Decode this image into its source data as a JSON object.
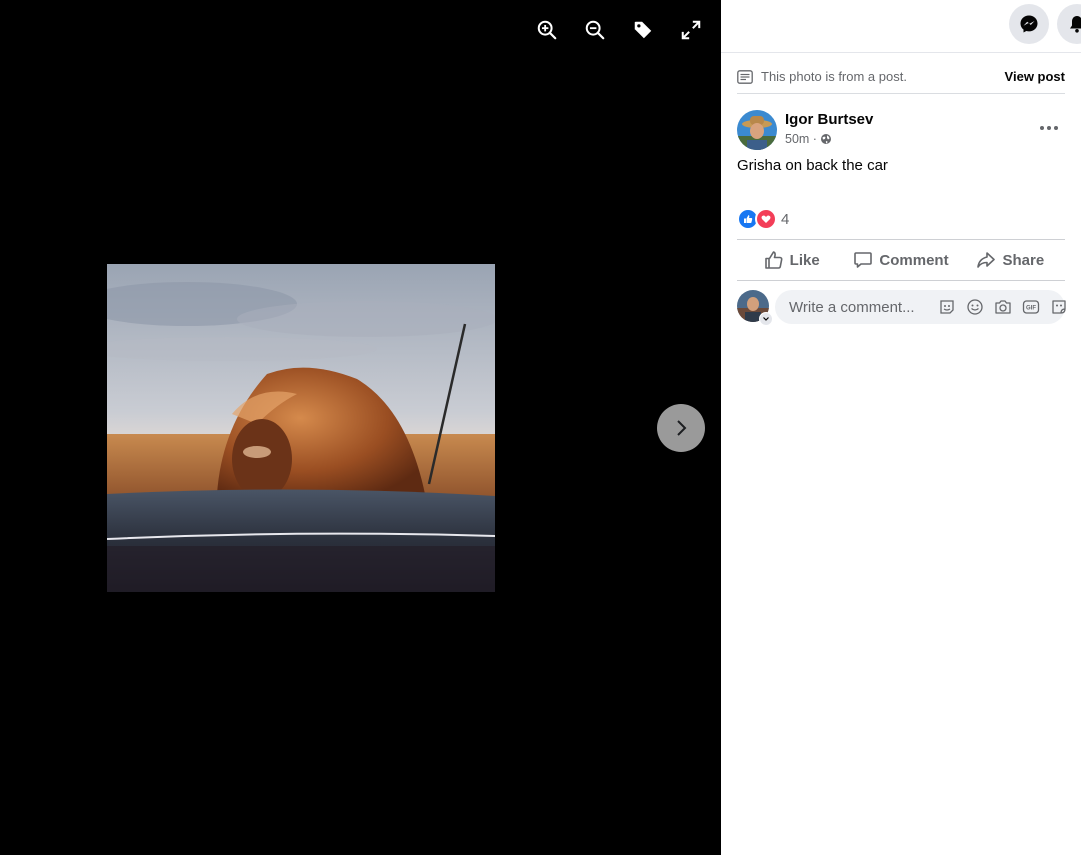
{
  "viewer": {
    "tools": [
      "zoom-in-icon",
      "zoom-out-icon",
      "tag-icon",
      "fullscreen-icon"
    ],
    "next_icon": "chevron-right-icon"
  },
  "panel": {
    "topbar": {
      "messenger_icon": "messenger-icon",
      "notifications_icon": "bell-icon"
    },
    "notice": {
      "text": "This photo is from a post.",
      "link": "View post"
    },
    "post": {
      "author": "Igor Burtsev",
      "time": "50m ·",
      "privacy_icon": "globe-icon",
      "caption": "Grisha on back the car",
      "reactions": {
        "icons": [
          "like-icon",
          "love-icon"
        ],
        "count": "4"
      },
      "actions": {
        "like": "Like",
        "comment": "Comment",
        "share": "Share"
      }
    },
    "comment_box": {
      "placeholder": "Write a comment...",
      "icons": [
        "avatar-sticker-icon",
        "emoji-icon",
        "camera-icon",
        "gif-icon",
        "sticker-icon"
      ]
    }
  },
  "colors": {
    "like_blue": "#1877f2",
    "love_red": "#f33e58",
    "text_secondary": "#65676b"
  }
}
